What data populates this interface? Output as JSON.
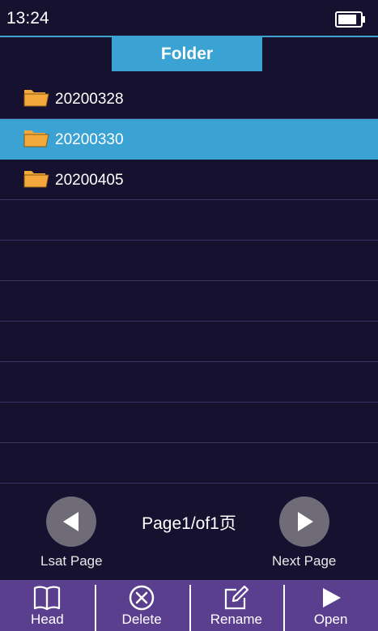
{
  "status": {
    "time": "13:24",
    "battery_level": 0.85
  },
  "header": {
    "title": "Folder"
  },
  "folders": [
    {
      "name": "20200328",
      "selected": false
    },
    {
      "name": "20200330",
      "selected": true
    },
    {
      "name": "20200405",
      "selected": false
    }
  ],
  "pagination": {
    "indicator": "Page1/of1页",
    "prev_label": "Lsat Page",
    "next_label": "Next Page"
  },
  "toolbar": {
    "head_label": "Head",
    "delete_label": "Delete",
    "rename_label": "Rename",
    "open_label": "Open"
  },
  "colors": {
    "background": "#16112f",
    "accent": "#3aa3d3",
    "toolbar": "#5a3f8f",
    "folder": "#f3a93b"
  }
}
